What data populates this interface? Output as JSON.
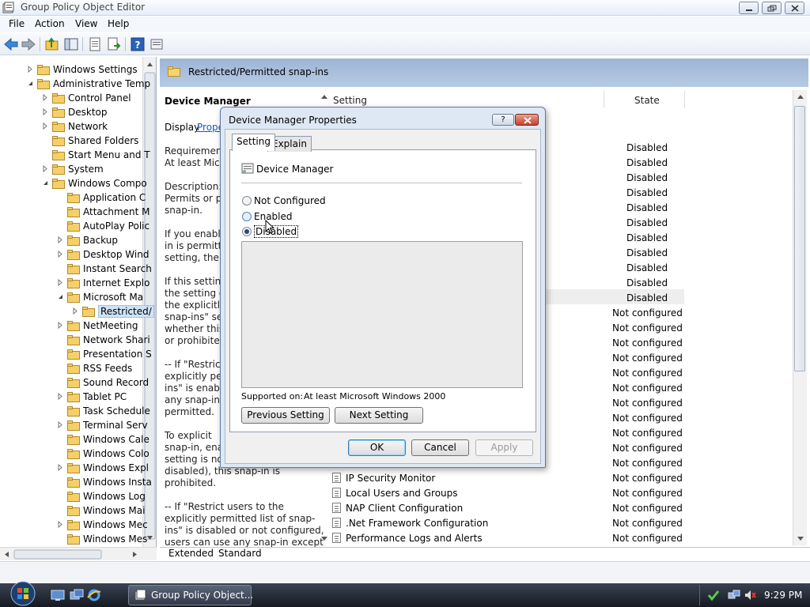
{
  "window": {
    "title": "Group Policy Object Editor"
  },
  "menu": {
    "file": "File",
    "action": "Action",
    "view": "View",
    "help": "Help"
  },
  "tree": {
    "items": [
      {
        "label": "Windows Settings",
        "level": 1,
        "expander": "closed"
      },
      {
        "label": "Administrative Temp",
        "level": 1,
        "expander": "open"
      },
      {
        "label": "Control Panel",
        "level": 2,
        "expander": "closed"
      },
      {
        "label": "Desktop",
        "level": 2,
        "expander": "closed"
      },
      {
        "label": "Network",
        "level": 2,
        "expander": "closed"
      },
      {
        "label": "Shared Folders",
        "level": 2,
        "expander": "none"
      },
      {
        "label": "Start Menu and T",
        "level": 2,
        "expander": "none"
      },
      {
        "label": "System",
        "level": 2,
        "expander": "closed"
      },
      {
        "label": "Windows Compo",
        "level": 2,
        "expander": "open"
      },
      {
        "label": "Application C",
        "level": 3,
        "expander": "none"
      },
      {
        "label": "Attachment M",
        "level": 3,
        "expander": "none"
      },
      {
        "label": "AutoPlay Polic",
        "level": 3,
        "expander": "none"
      },
      {
        "label": "Backup",
        "level": 3,
        "expander": "closed"
      },
      {
        "label": "Desktop Wind",
        "level": 3,
        "expander": "closed"
      },
      {
        "label": "Instant Search",
        "level": 3,
        "expander": "none"
      },
      {
        "label": "Internet Explo",
        "level": 3,
        "expander": "closed"
      },
      {
        "label": "Microsoft Ma",
        "level": 3,
        "expander": "open"
      },
      {
        "label": "Restricted/",
        "level": 4,
        "expander": "closed",
        "selected": true
      },
      {
        "label": "NetMeeting",
        "level": 3,
        "expander": "closed"
      },
      {
        "label": "Network Shari",
        "level": 3,
        "expander": "none"
      },
      {
        "label": "Presentation S",
        "level": 3,
        "expander": "none"
      },
      {
        "label": "RSS Feeds",
        "level": 3,
        "expander": "none"
      },
      {
        "label": "Sound Record",
        "level": 3,
        "expander": "none"
      },
      {
        "label": "Tablet PC",
        "level": 3,
        "expander": "closed"
      },
      {
        "label": "Task Schedule",
        "level": 3,
        "expander": "none"
      },
      {
        "label": "Terminal Serv",
        "level": 3,
        "expander": "closed"
      },
      {
        "label": "Windows Cale",
        "level": 3,
        "expander": "none"
      },
      {
        "label": "Windows Colo",
        "level": 3,
        "expander": "none"
      },
      {
        "label": "Windows Expl",
        "level": 3,
        "expander": "closed"
      },
      {
        "label": "Windows Insta",
        "level": 3,
        "expander": "none"
      },
      {
        "label": "Windows Log",
        "level": 3,
        "expander": "none"
      },
      {
        "label": "Windows Mai",
        "level": 3,
        "expander": "none"
      },
      {
        "label": "Windows Mec",
        "level": 3,
        "expander": "closed"
      },
      {
        "label": "Windows Mes",
        "level": 3,
        "expander": "none"
      }
    ]
  },
  "right": {
    "header_title": "Restricted/Permitted snap-ins",
    "desc_title": "Device Manager",
    "desc_display": "Display",
    "desc_display_link": "Prope",
    "desc_lines": [
      "Requirement",
      "At least Micr",
      "",
      "Description:",
      "Permits or pr",
      "snap-in.",
      "",
      "If you enable",
      "in is permitte",
      "setting, the s",
      "",
      "If this setting",
      "the setting of",
      "the explicitly",
      "snap-ins\" se",
      "whether this",
      "or prohibited",
      "",
      "-- If \"Restrict",
      "explicitly per",
      "ins\" is enable",
      "any snap-in e",
      "permitted.",
      "",
      "    To explicit",
      "snap-in, enal",
      "setting is not",
      "disabled), this snap-in is",
      "prohibited.",
      "",
      "-- If \"Restrict users to the",
      "explicitly permitted list of snap-",
      "ins\" is disabled or not configured,",
      "users can use any snap-in except"
    ],
    "col_setting": "Setting",
    "col_state": "State",
    "states": [
      "Disabled",
      "Disabled",
      "Disabled",
      "Disabled",
      "Disabled",
      "Disabled",
      "Disabled",
      "Disabled",
      "Disabled",
      "Disabled",
      "Disabled",
      "Not configured",
      "Not configured",
      "Not configured",
      "Not configured",
      "Not configured",
      "Not configured",
      "Not configured",
      "Not configured",
      "Not configured",
      "Not configured",
      "Not configured",
      "Not configured",
      "Not configured",
      "Not configured",
      "Not configured",
      "Not configured"
    ],
    "visible_settings": [
      "IP Security Monitor",
      "Local Users and Groups",
      "NAP Client Configuration",
      ".Net Framework Configuration",
      "Performance Logs and Alerts"
    ],
    "bottom_tabs": {
      "extended": "Extended",
      "standard": "Standard"
    }
  },
  "dialog": {
    "title": "Device Manager Properties",
    "help_btn": "?",
    "tabs": {
      "setting": "Setting",
      "explain": "Explain"
    },
    "policy_name": "Device Manager",
    "options": {
      "not_configured": "Not Configured",
      "enabled": "Enabled",
      "disabled": "Disabled",
      "selected": "disabled"
    },
    "supported_label": "Supported on:",
    "supported_value": "At least Microsoft Windows 2000",
    "prev_btn": "Previous Setting",
    "next_btn": "Next Setting",
    "ok": "OK",
    "cancel": "Cancel",
    "apply": "Apply"
  },
  "taskbar": {
    "task_label": "Group Policy Object...",
    "clock": "9:29 PM"
  },
  "colors": {
    "header_band": "#9db5d6",
    "selection": "#cfe3f8",
    "dialog_frame": "#dde8f4",
    "close_button": "#c6412a",
    "taskbar": "#1f2530"
  }
}
